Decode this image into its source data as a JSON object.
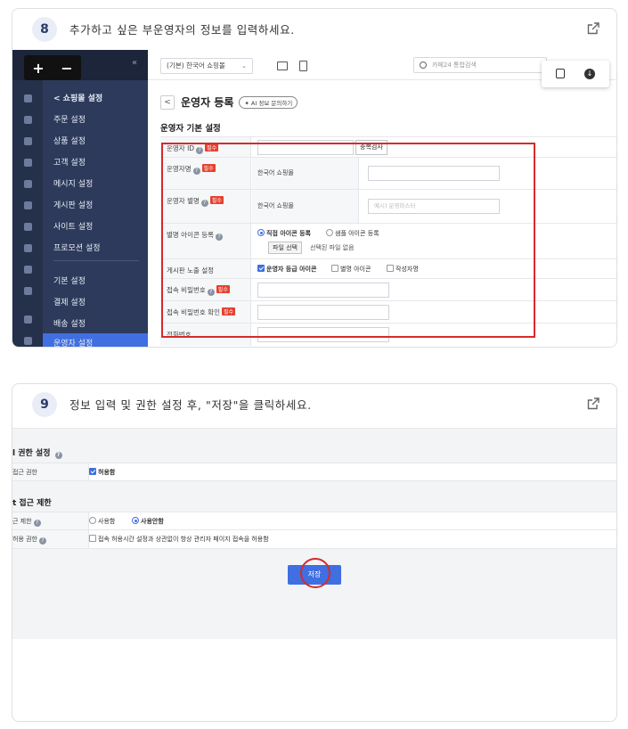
{
  "step8": {
    "number": "8",
    "title": "추가하고 싶은 부운영자의 정보를 입력하세요.",
    "screenshot": {
      "sidebar": {
        "plus": "+",
        "minus": "−",
        "collapse": "«",
        "items": [
          "< 쇼핑몰 설정",
          "주문 설정",
          "상품 설정",
          "고객 설정",
          "메시지 설정",
          "게시판 설정",
          "사이트 설정",
          "프로모션 설정",
          "기본 설정",
          "결제 설정",
          "배송 설정",
          "운영자 설정"
        ]
      },
      "topbar": {
        "mall_select": "(기본) 한국어 쇼핑몰",
        "caret": "⌄",
        "search_placeholder": "카페24 통합검색"
      },
      "page_title": "운영자 등록",
      "ai_pill": "✦ AI 정보 문의하기",
      "back": "<",
      "section_title": "운영자 기본 설정",
      "required_tag": "필수",
      "fields": {
        "id_label": "운영자 ID",
        "dup_check": "중복검사",
        "name_label": "운영자명",
        "name_sub": "한국어 쇼핑몰",
        "alias_label": "운영자 별명",
        "alias_sub": "한국어 쇼핑몰",
        "alias_placeholder": "예시) 운영마스터",
        "icon_label": "별명 아이콘 등록",
        "icon_opt_direct": "직접 아이콘 등록",
        "icon_opt_sample": "샘플 아이콘 등록",
        "file_select": "파일 선택",
        "no_file": "선택된 파일 없음",
        "board_label": "게시판 노출 설정",
        "board_opt1": "운영자 등급 아이콘",
        "board_opt2": "별명 아이콘",
        "board_opt3": "작성자명",
        "pw_label": "접속 비밀번호",
        "pw_confirm_label": "접속 비밀번호 확인",
        "phone_label": "전화번호"
      }
    }
  },
  "step9": {
    "number": "9",
    "title": "정보 입력 및 권한 설정 후, \"저장\"을 클릭하세요.",
    "screenshot": {
      "section_auth": "l 권한 설정",
      "access_label": "접근 권한",
      "access_value": "허용함",
      "section_restrict": "t 접근 제한",
      "restrict_label": "근 제한",
      "restrict_use": "사용함",
      "restrict_nouse": "사용안함",
      "allow_label": "허용 권한",
      "allow_value": "접속 허용시간 설정과 상관없이 항상 관리자 페이지 접속을 허용함",
      "save": "저장"
    }
  },
  "colors": {
    "accent": "#3f6fe0",
    "highlight": "#d62b2b",
    "sidebar": "#2d3a5b"
  }
}
